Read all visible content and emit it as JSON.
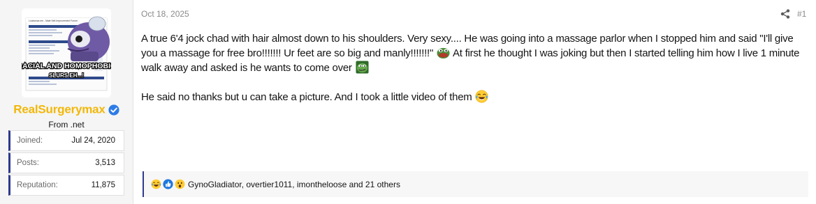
{
  "post": {
    "date": "Oct 18, 2025",
    "number": "#1",
    "user": {
      "name": "RealSurgerymax",
      "title": "From .net",
      "avatar_text": {
        "header": "Looksmax.me - Male Self-Improvement Forum",
        "caption_line1": "RACIAL AND HOMOPHOBIC",
        "caption_line2": "SLURS EH...!"
      },
      "stats": [
        {
          "key": "Joined:",
          "value": "Jul 24, 2020"
        },
        {
          "key": "Posts:",
          "value": "3,513"
        },
        {
          "key": "Reputation:",
          "value": "11,875"
        }
      ]
    },
    "body": {
      "para1_a": "A true 6'4 jock chad with hair almost down to his shoulders. Very sexy.... He was going into a massage parlor when I stopped him and said \"I'll give you a massage for free bro!!!!!!! Ur feet are so big and manly!!!!!!!\"",
      "para1_b": " At first he thought I was joking but then I started telling him how I live 1 minute walk away and asked is he wants to come over",
      "para2": "He said no thanks but u can take a picture. And I took a little video of them"
    },
    "reactions": {
      "icons": [
        "crying-laughing-icon",
        "thumbs-up-icon",
        "surprised-face-icon"
      ],
      "users_text": "GynoGladiator, overtier1011, imontheloose and 21 others"
    }
  }
}
